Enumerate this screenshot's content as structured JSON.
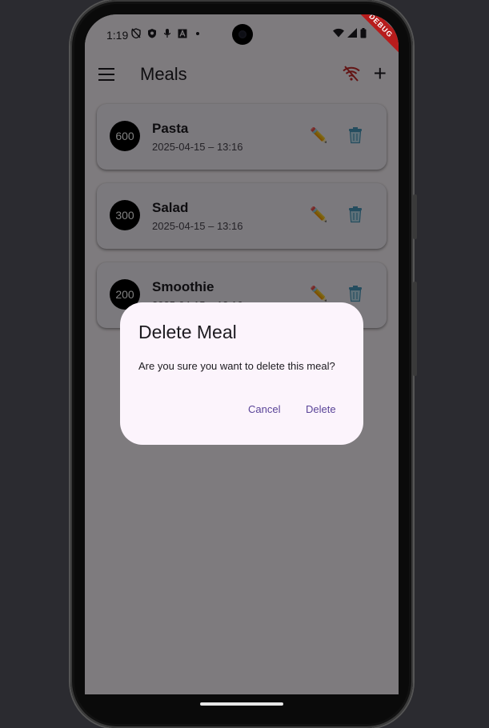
{
  "status_bar": {
    "time": "1:19",
    "icons_left": [
      "shield-off-icon",
      "shield-icon",
      "mic-icon",
      "a-icon",
      "dot-icon"
    ],
    "icons_right": [
      "wifi-icon",
      "signal-icon",
      "battery-icon"
    ],
    "debug_banner": "DEBUG"
  },
  "app_bar": {
    "title": "Meals",
    "icons": [
      "menu-icon",
      "wifi-off-icon",
      "add-icon"
    ],
    "wifi_off_color": "#c62828"
  },
  "meals": [
    {
      "calories": "600",
      "name": "Pasta",
      "date": "2025-04-15 – 13:16"
    },
    {
      "calories": "300",
      "name": "Salad",
      "date": "2025-04-15 – 13:16"
    },
    {
      "calories": "200",
      "name": "Smoothie",
      "date": "2025-04-15 – 13:16"
    }
  ],
  "dialog": {
    "title": "Delete Meal",
    "message": "Are you sure you want to delete this meal?",
    "cancel_label": "Cancel",
    "delete_label": "Delete",
    "accent_color": "#5a4498"
  }
}
